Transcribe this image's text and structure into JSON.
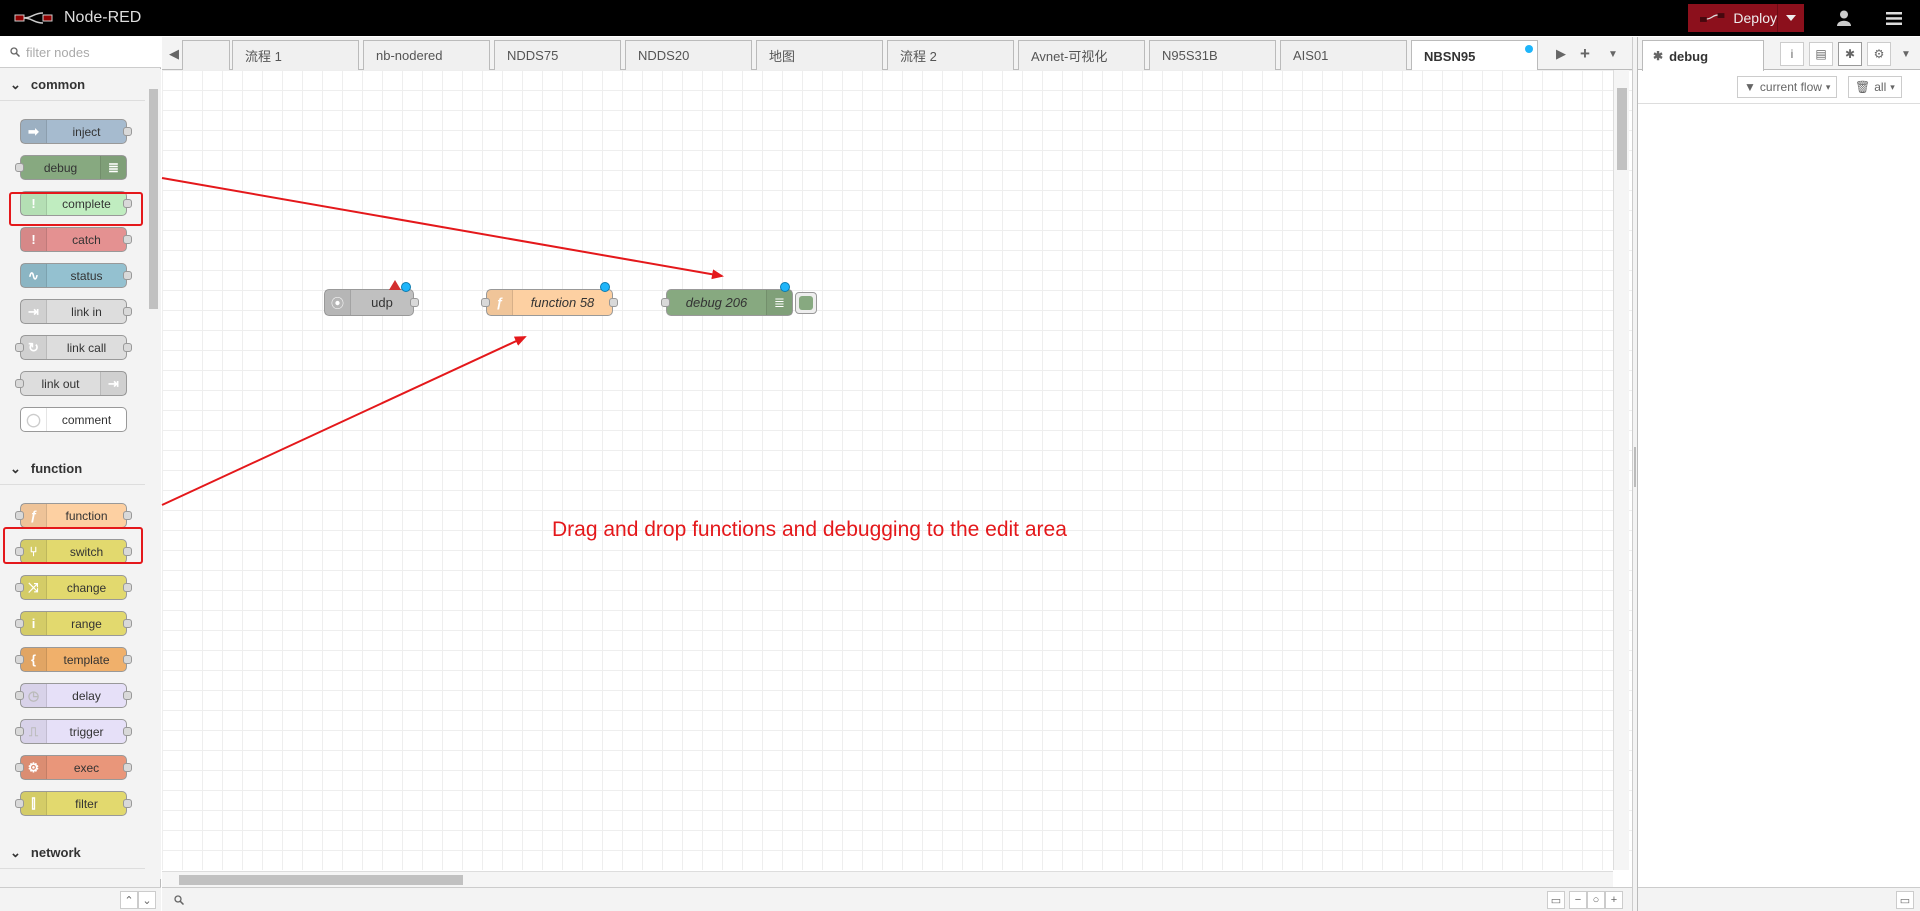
{
  "header": {
    "app_title": "Node-RED",
    "deploy_label": "Deploy",
    "brand_color": "#8c101c",
    "icons": [
      "node-red-logo",
      "user-icon",
      "menu-icon"
    ]
  },
  "palette": {
    "search_placeholder": "filter nodes",
    "categories": [
      {
        "name": "common",
        "nodes": [
          {
            "label": "inject",
            "color": "#a6bbcf",
            "icon": "arrow-right-icon",
            "ports": "out"
          },
          {
            "label": "debug",
            "color": "#87a980",
            "icon": "list-icon",
            "ports": "in"
          },
          {
            "label": "complete",
            "color": "#c0edc0",
            "icon": "exclamation-icon",
            "ports": "out"
          },
          {
            "label": "catch",
            "color": "#e49191",
            "icon": "exclamation-icon",
            "ports": "out"
          },
          {
            "label": "status",
            "color": "#94c1d0",
            "icon": "pulse-icon",
            "ports": "out"
          },
          {
            "label": "link in",
            "color": "#dddddd",
            "icon": "link-icon",
            "ports": "out"
          },
          {
            "label": "link call",
            "color": "#dddddd",
            "icon": "link-icon",
            "ports": "both"
          },
          {
            "label": "link out",
            "color": "#dddddd",
            "icon": "link-icon",
            "ports": "in"
          },
          {
            "label": "comment",
            "color": "#ffffff",
            "icon": "comment-icon",
            "ports": "none"
          }
        ]
      },
      {
        "name": "function",
        "nodes": [
          {
            "label": "function",
            "color": "#fdd0a2",
            "icon": "function-icon",
            "ports": "both"
          },
          {
            "label": "switch",
            "color": "#e2d96e",
            "icon": "switch-icon",
            "ports": "both"
          },
          {
            "label": "change",
            "color": "#e2d96e",
            "icon": "shuffle-icon",
            "ports": "both"
          },
          {
            "label": "range",
            "color": "#e2d96e",
            "icon": "range-icon",
            "ports": "both"
          },
          {
            "label": "template",
            "color": "#f0b06b",
            "icon": "brace-icon",
            "ports": "both"
          },
          {
            "label": "delay",
            "color": "#e6e0f8",
            "icon": "timer-icon",
            "ports": "both"
          },
          {
            "label": "trigger",
            "color": "#e6e0f8",
            "icon": "trigger-icon",
            "ports": "both"
          },
          {
            "label": "exec",
            "color": "#e9967a",
            "icon": "gear-icon",
            "ports": "both"
          },
          {
            "label": "filter",
            "color": "#e2d96e",
            "icon": "filter-icon",
            "ports": "both"
          }
        ]
      },
      {
        "name": "network",
        "nodes": []
      }
    ]
  },
  "workspace": {
    "tabs": [
      "",
      "流程 1",
      "nb-nodered",
      "NDDS75",
      "NDDS20",
      "地图",
      "流程 2",
      "Avnet-可视化",
      "N95S31B",
      "AIS01",
      "NBSN95"
    ],
    "active_tab": "NBSN95",
    "nodes": [
      {
        "label": "udp",
        "type": "udp",
        "color": "#c0c0c0"
      },
      {
        "label": "function 58",
        "type": "function",
        "color": "#fdd0a2"
      },
      {
        "label": "debug 206",
        "type": "debug",
        "color": "#87a980"
      }
    ],
    "annotation": "Drag and drop functions and debugging to the edit area"
  },
  "sidebar": {
    "tab_label": "debug",
    "filter_label": "current flow",
    "clear_label": "all"
  }
}
